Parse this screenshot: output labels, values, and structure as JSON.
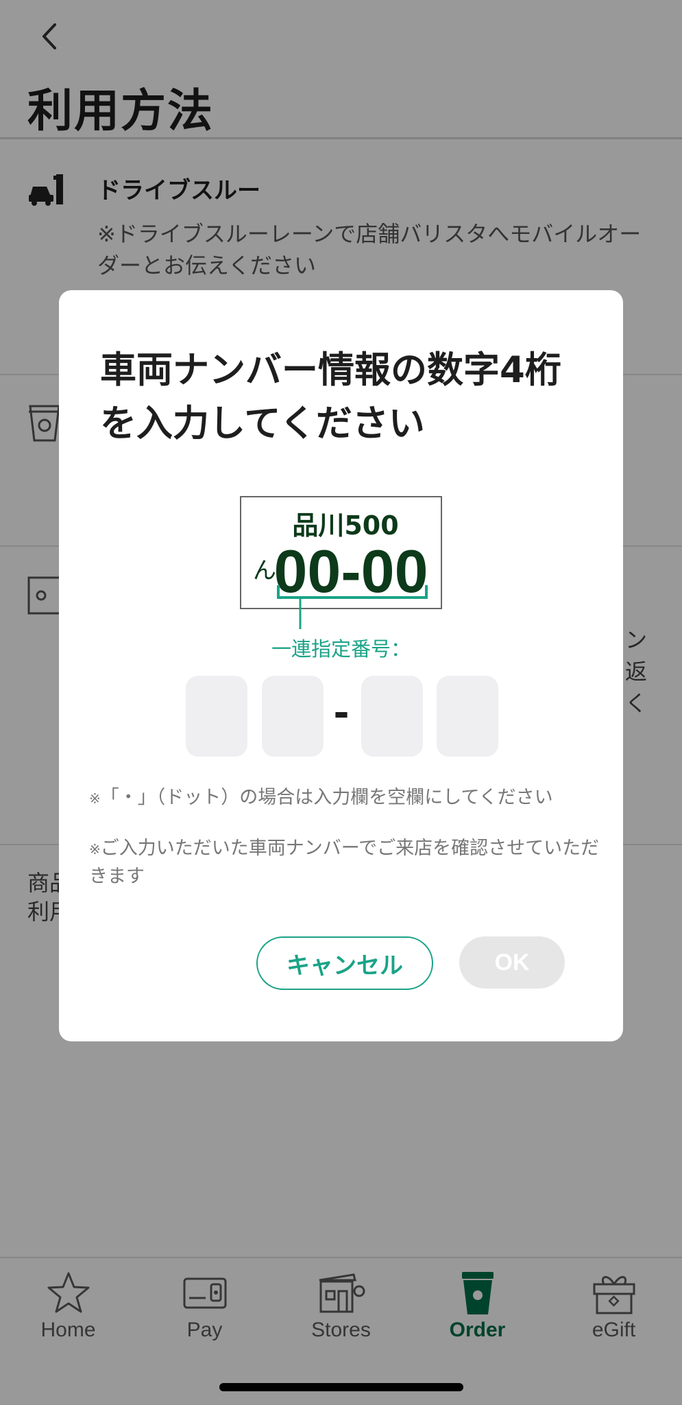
{
  "header": {
    "title": "利用方法"
  },
  "drive_through": {
    "title": "ドライブスルー",
    "description": "※ドライブスルーレーンで店舗バリスタへモバイルオーダーとお伝えください"
  },
  "background_partial": {
    "right_lines": [
      "ン",
      "返",
      "く"
    ],
    "bottom_left_lines": [
      "商品",
      "利用"
    ]
  },
  "dialog": {
    "title": "車両ナンバー情報の数字4桁を入力してください",
    "plate": {
      "region": "品川500",
      "kana": "ん",
      "number": "00-00"
    },
    "caption": "一連指定番号：",
    "dash": "-",
    "note_1_mark": "※",
    "note_1": "「・」（ドット）の場合は入力欄を空欄にしてください",
    "note_2_mark": "※",
    "note_2": "ご入力いただいた車両ナンバーでご来店を確認させていただきます",
    "cancel_label": "キャンセル",
    "ok_label": "OK"
  },
  "tabs": [
    {
      "label": "Home",
      "icon": "star-icon"
    },
    {
      "label": "Pay",
      "icon": "card-icon"
    },
    {
      "label": "Stores",
      "icon": "store-icon"
    },
    {
      "label": "Order",
      "icon": "cup-icon",
      "active": true
    },
    {
      "label": "eGift",
      "icon": "gift-icon"
    }
  ],
  "colors": {
    "accent": "#1aa387",
    "brand_green": "#00704a",
    "overlay": "rgba(0,0,0,0.40)"
  }
}
